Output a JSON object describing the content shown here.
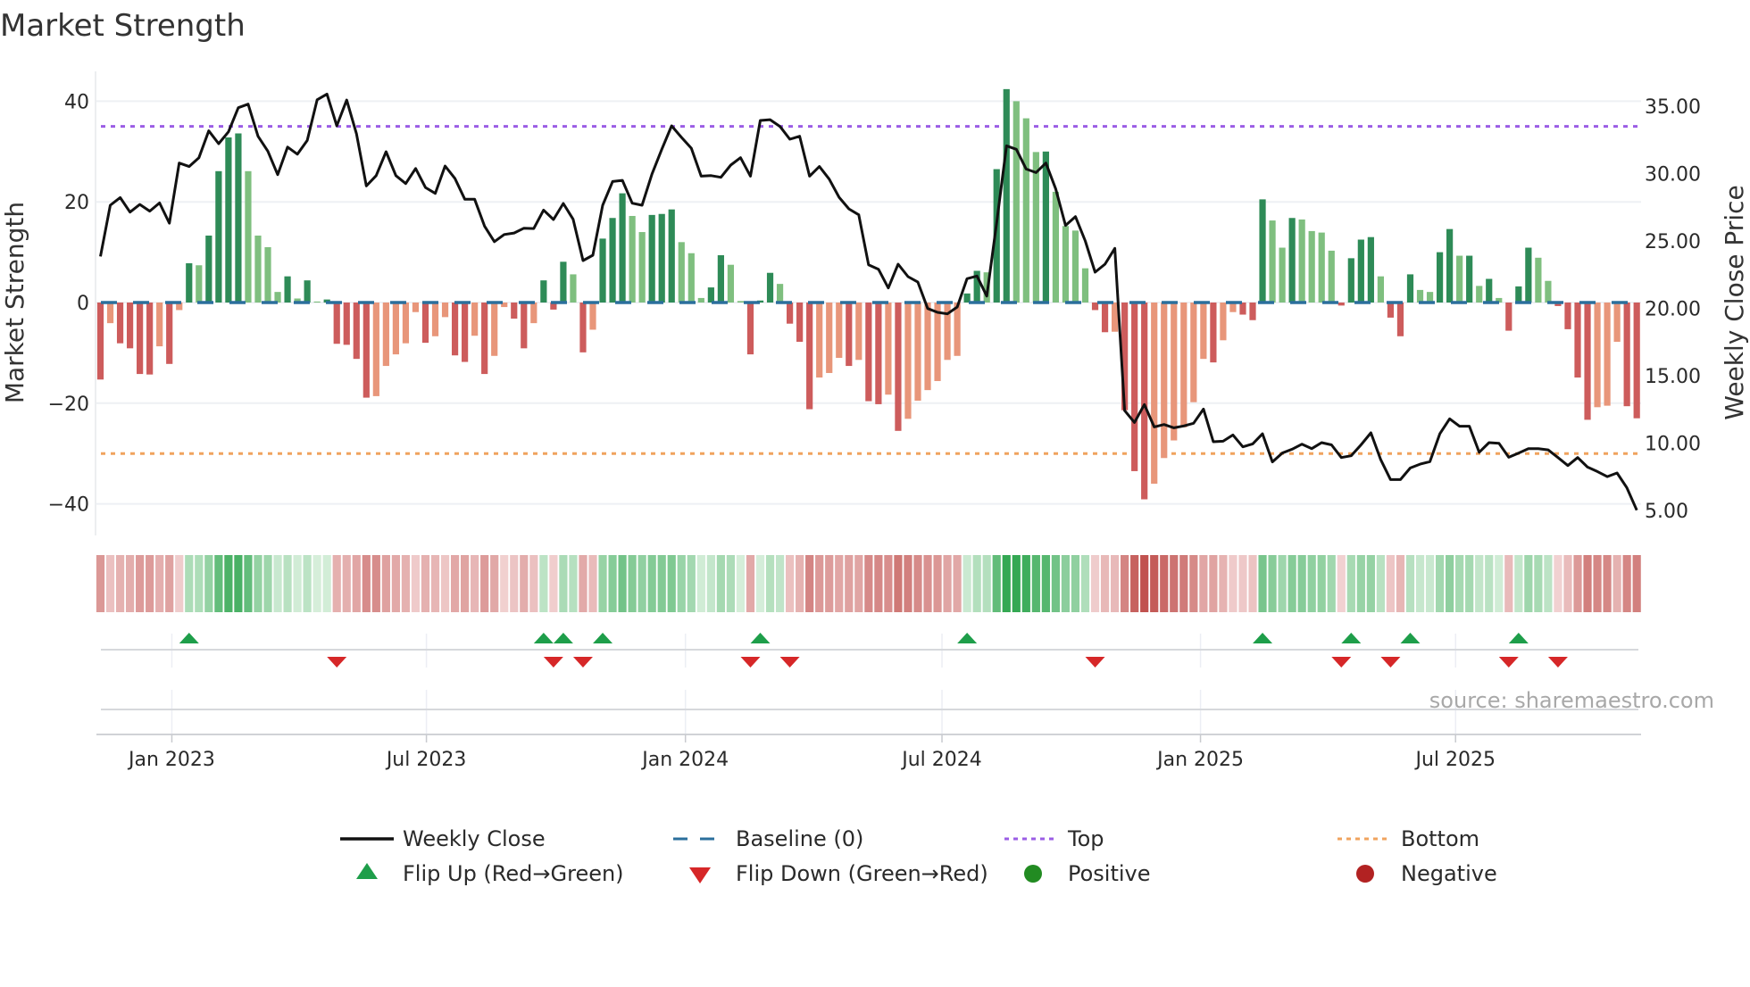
{
  "title": "Market Strength",
  "source": "source: sharemaestro.com",
  "colors": {
    "pos_strong": "#2e8b57",
    "pos_weak": "#7fbf7f",
    "neg_strong": "#cd5c5c",
    "neg_weak": "#e8967a",
    "baseline": "#2b6f9c",
    "top": "#9b5de5",
    "bottom": "#f0a35e",
    "flip_up": "#1e9e4a",
    "flip_down": "#d62728",
    "positive": "#228b22",
    "negative": "#b22222"
  },
  "legend": {
    "weekly_close": "Weekly Close",
    "baseline": "Baseline (0)",
    "top": "Top",
    "bottom": "Bottom",
    "flip_up": "Flip Up (Red→Green)",
    "flip_down": "Flip Down (Green→Red)",
    "positive": "Positive",
    "negative": "Negative"
  },
  "chart_data": {
    "type": "bar",
    "title": "Market Strength",
    "ylabel": "Market Strength",
    "y2label": "Weekly Close Price",
    "ylim": [
      -42,
      47
    ],
    "y2lim": [
      3.9,
      38.3
    ],
    "yticks": [
      40,
      20,
      0,
      -20,
      -40
    ],
    "yticklabels": [
      "40",
      "20",
      "0",
      "−20",
      "−40"
    ],
    "y2ticks": [
      35,
      30,
      25,
      20,
      15,
      10,
      5
    ],
    "y2ticklabels": [
      "35.00",
      "30.00",
      "25.00",
      "20.00",
      "15.00",
      "10.00",
      "5.00"
    ],
    "xticks": [
      {
        "week": 8.25,
        "label": "Jan 2023"
      },
      {
        "week": 34.1,
        "label": "Jul 2023"
      },
      {
        "week": 60.4,
        "label": "Jan 2024"
      },
      {
        "week": 86.45,
        "label": "Jul 2024"
      },
      {
        "week": 112.7,
        "label": "Jan 2025"
      },
      {
        "week": 138.6,
        "label": "Jul 2025"
      }
    ],
    "top_level": 35,
    "bottom_level": -30,
    "baseline": 0,
    "strength": [
      -15.3,
      -4.1,
      -8.1,
      -9.1,
      -14.2,
      -14.3,
      -8.7,
      -12.2,
      -1.5,
      7.8,
      7.4,
      13.3,
      26.1,
      32.8,
      33.6,
      26.1,
      13.3,
      11.0,
      2.1,
      5.2,
      0.8,
      4.4,
      0.2,
      0.6,
      -8.2,
      -8.4,
      -11.2,
      -18.9,
      -18.6,
      -12.6,
      -10.3,
      -8.1,
      -1.9,
      -8.0,
      -6.7,
      -2.9,
      -10.5,
      -11.8,
      -6.6,
      -14.2,
      -10.6,
      -0.9,
      -3.2,
      -9.1,
      -4.1,
      4.4,
      -1.4,
      8.1,
      5.6,
      -9.9,
      -5.4,
      12.7,
      16.8,
      21.7,
      17.2,
      14.0,
      17.4,
      17.6,
      18.5,
      12.0,
      9.8,
      0.9,
      3.0,
      9.4,
      7.5,
      0.3,
      -10.3,
      0.4,
      5.9,
      3.7,
      -4.2,
      -7.8,
      -21.2,
      -14.9,
      -14.0,
      -11.0,
      -12.6,
      -11.4,
      -19.6,
      -20.2,
      -18.3,
      -25.5,
      -23.1,
      -19.5,
      -17.4,
      -15.6,
      -11.4,
      -10.6,
      1.8,
      6.3,
      6.0,
      26.5,
      42.4,
      40.0,
      36.6,
      29.9,
      30.0,
      22.0,
      15.2,
      14.3,
      6.8,
      -1.5,
      -5.9,
      -5.8,
      -21.4,
      -33.5,
      -39.1,
      -36.0,
      -30.9,
      -27.4,
      -24.8,
      -19.8,
      -11.2,
      -11.9,
      -7.5,
      -1.9,
      -2.4,
      -3.5,
      20.5,
      16.3,
      10.9,
      16.8,
      16.5,
      14.2,
      13.9,
      10.3,
      -0.6,
      8.8,
      12.5,
      13.0,
      5.2,
      -3.0,
      -6.7,
      5.6,
      2.5,
      2.1,
      10.0,
      14.6,
      9.3,
      9.3,
      3.3,
      4.7,
      0.9,
      -5.6,
      3.2,
      10.9,
      8.9,
      4.3,
      -0.7,
      -5.3,
      -14.9,
      -23.3,
      -20.8,
      -20.5,
      -7.8,
      -20.6,
      -23.0
    ],
    "shade": "DLDDDDLDLDLDDDDLLLLDLDLDDDDDLLLLLDLLDDLDLLDDLDDDLDLDDDLLDDDLLLDDLLDDDLDDDLLLDLDDLDLLLLLLDDLDDLLLDLLLLDDLDDDLLLLLLDLLDDDLLDLLLLDDDDLDDDLLDDLDLDLDDDLLDDDDLLLDD",
    "weekly_close": [
      23.85,
      27.65,
      28.22,
      27.14,
      27.71,
      27.21,
      27.82,
      26.32,
      30.78,
      30.52,
      31.18,
      33.17,
      32.22,
      33.1,
      34.89,
      35.15,
      32.77,
      31.66,
      29.92,
      31.97,
      31.44,
      32.46,
      35.48,
      35.9,
      33.54,
      35.46,
      32.94,
      29.08,
      29.85,
      31.62,
      29.85,
      29.26,
      30.38,
      28.97,
      28.53,
      30.56,
      29.63,
      28.09,
      28.09,
      26.1,
      24.95,
      25.48,
      25.59,
      25.95,
      25.92,
      27.29,
      26.59,
      27.78,
      26.61,
      23.54,
      23.94,
      27.65,
      29.41,
      29.5,
      27.8,
      27.65,
      29.96,
      31.8,
      33.54,
      32.68,
      31.88,
      29.81,
      29.85,
      29.72,
      30.63,
      31.18,
      29.81,
      33.94,
      34.0,
      33.5,
      32.55,
      32.77,
      29.81,
      30.52,
      29.59,
      28.24,
      27.38,
      26.94,
      23.23,
      22.9,
      21.51,
      23.28,
      22.35,
      21.95,
      19.99,
      19.7,
      19.59,
      20.1,
      22.2,
      22.4,
      20.91,
      26.32,
      32.06,
      31.8,
      30.34,
      30.07,
      30.78,
      28.86,
      26.15,
      26.81,
      25.0,
      22.68,
      23.28,
      24.45,
      12.41,
      11.53,
      12.86,
      11.2,
      11.38,
      11.13,
      11.27,
      11.47,
      12.52,
      10.1,
      10.14,
      10.6,
      9.72,
      9.94,
      10.69,
      8.6,
      9.26,
      9.54,
      9.92,
      9.59,
      10.03,
      9.87,
      8.93,
      9.06,
      9.87,
      10.76,
      8.77,
      7.29,
      7.29,
      8.15,
      8.44,
      8.62,
      10.69,
      11.8,
      11.25,
      11.25,
      9.32,
      10.03,
      9.99,
      8.95,
      9.26,
      9.59,
      9.59,
      9.5,
      8.93,
      8.33,
      8.93,
      8.22,
      7.89,
      7.51,
      7.78,
      6.68,
      5.02
    ],
    "flip_up_weeks": [
      10,
      46,
      48,
      52,
      68,
      89,
      119,
      128,
      134,
      145
    ],
    "flip_down_weeks": [
      25,
      47,
      50,
      67,
      71,
      102,
      127,
      132,
      144,
      149
    ],
    "legend_position": "bottom"
  }
}
